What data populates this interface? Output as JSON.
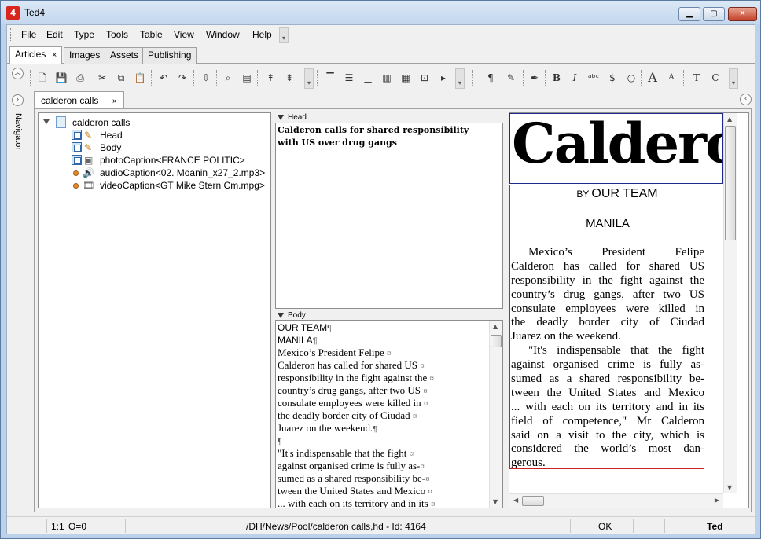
{
  "window": {
    "title": "Ted4",
    "app_icon": "4"
  },
  "menu": [
    "File",
    "Edit",
    "Type",
    "Tools",
    "Table",
    "View",
    "Window",
    "Help"
  ],
  "main_tabs": [
    {
      "label": "Articles",
      "active": true,
      "close": "×"
    },
    {
      "label": "Images"
    },
    {
      "label": "Assets"
    },
    {
      "label": "Publishing"
    }
  ],
  "toolbar_icons": [
    "new-icon",
    "save-icon",
    "print-icon",
    "cut-icon",
    "copy-icon",
    "paste-icon",
    "undo-icon",
    "redo-icon",
    "import-icon",
    "find-icon",
    "properties-icon",
    "move-up-icon",
    "move-down-icon",
    "align-top-icon",
    "align-middle-icon",
    "align-bottom-icon",
    "distribute-icon",
    "group-icon",
    "frame-icon",
    "play-icon",
    "pilcrow-icon",
    "pen-icon",
    "nib-icon",
    "bold-icon",
    "italic-icon",
    "spell-icon",
    "dollar-icon",
    "circle-icon",
    "font-larger-icon",
    "font-smaller-icon",
    "text-icon",
    "case-icon"
  ],
  "navigator": {
    "label": "Navigator"
  },
  "article_tab": {
    "label": "calderon calls",
    "close": "×"
  },
  "tree": {
    "root": "calderon calls",
    "items": [
      {
        "label": "Head",
        "icon": "frame-edit-icon"
      },
      {
        "label": "Body",
        "icon": "frame-edit-icon"
      },
      {
        "label": "photoCaption<FRANCE POLITIC>",
        "icon": "photo-frame-icon"
      },
      {
        "label": "audioCaption<02. Moanin_x27_2.mp3>",
        "icon": "audio-icon"
      },
      {
        "label": "videoCaption<GT Mike Stern Cm.mpg>",
        "icon": "video-icon"
      }
    ]
  },
  "head_panel": {
    "label": "Head",
    "lines": [
      "Calderon calls for shared responsibility",
      "with US over drug gangs"
    ]
  },
  "body_panel": {
    "label": "Body",
    "lines": [
      {
        "text": "OUR TEAM",
        "mark": "¶"
      },
      {
        "text": "MANILA",
        "mark": "¶"
      },
      {
        "text": "Mexico’s President Felipe ",
        "mark": "¤"
      },
      {
        "text": "Calderon has called for shared US ",
        "mark": "¤"
      },
      {
        "text": "responsibility in the fight against the ",
        "mark": "¤"
      },
      {
        "text": "country’s drug gangs, after two US ",
        "mark": "¤"
      },
      {
        "text": "consulate employees were killed in ",
        "mark": "¤"
      },
      {
        "text": "the deadly border city of Ciudad ",
        "mark": "¤"
      },
      {
        "text": "Juarez on the weekend.",
        "mark": "¶"
      },
      {
        "text": "",
        "mark": "¶"
      },
      {
        "text": "\"It's indispensable that the fight ",
        "mark": "¤"
      },
      {
        "text": "against organised crime is fully as-",
        "mark": "¤"
      },
      {
        "text": "sumed as a shared responsibility be-",
        "mark": "¤"
      },
      {
        "text": "tween the United States and Mexico ",
        "mark": "¤"
      },
      {
        "text": "... with each on its territory and in its ",
        "mark": "¤"
      }
    ]
  },
  "preview": {
    "headline": "Calderon",
    "byline_prefix": "BY",
    "byline": "OUR TEAM",
    "dateline": "MANILA",
    "lines": [
      "Mexico’s President Felipe",
      "Calderon has called for shared US",
      "responsibility in the fight against the",
      "country’s drug gangs, after two US",
      "consulate employees were killed in",
      "the deadly border city of Ciudad",
      "Juarez on the weekend.",
      "\"It's indispensable that the fight",
      "against organised crime is fully as-",
      "sumed as a shared responsibility be-",
      "tween the United States and Mexico",
      "... with each on its territory and in its",
      "field of competence,\" Mr Calderon",
      "said on a visit to the city, which is",
      "considered the world’s most dan-",
      "gerous."
    ]
  },
  "status": {
    "position": "1:1",
    "overset": "O=0",
    "path": "/DH/News/Pool/calderon calls,hd - Id: 4164",
    "state": "OK",
    "user": "Ted"
  }
}
